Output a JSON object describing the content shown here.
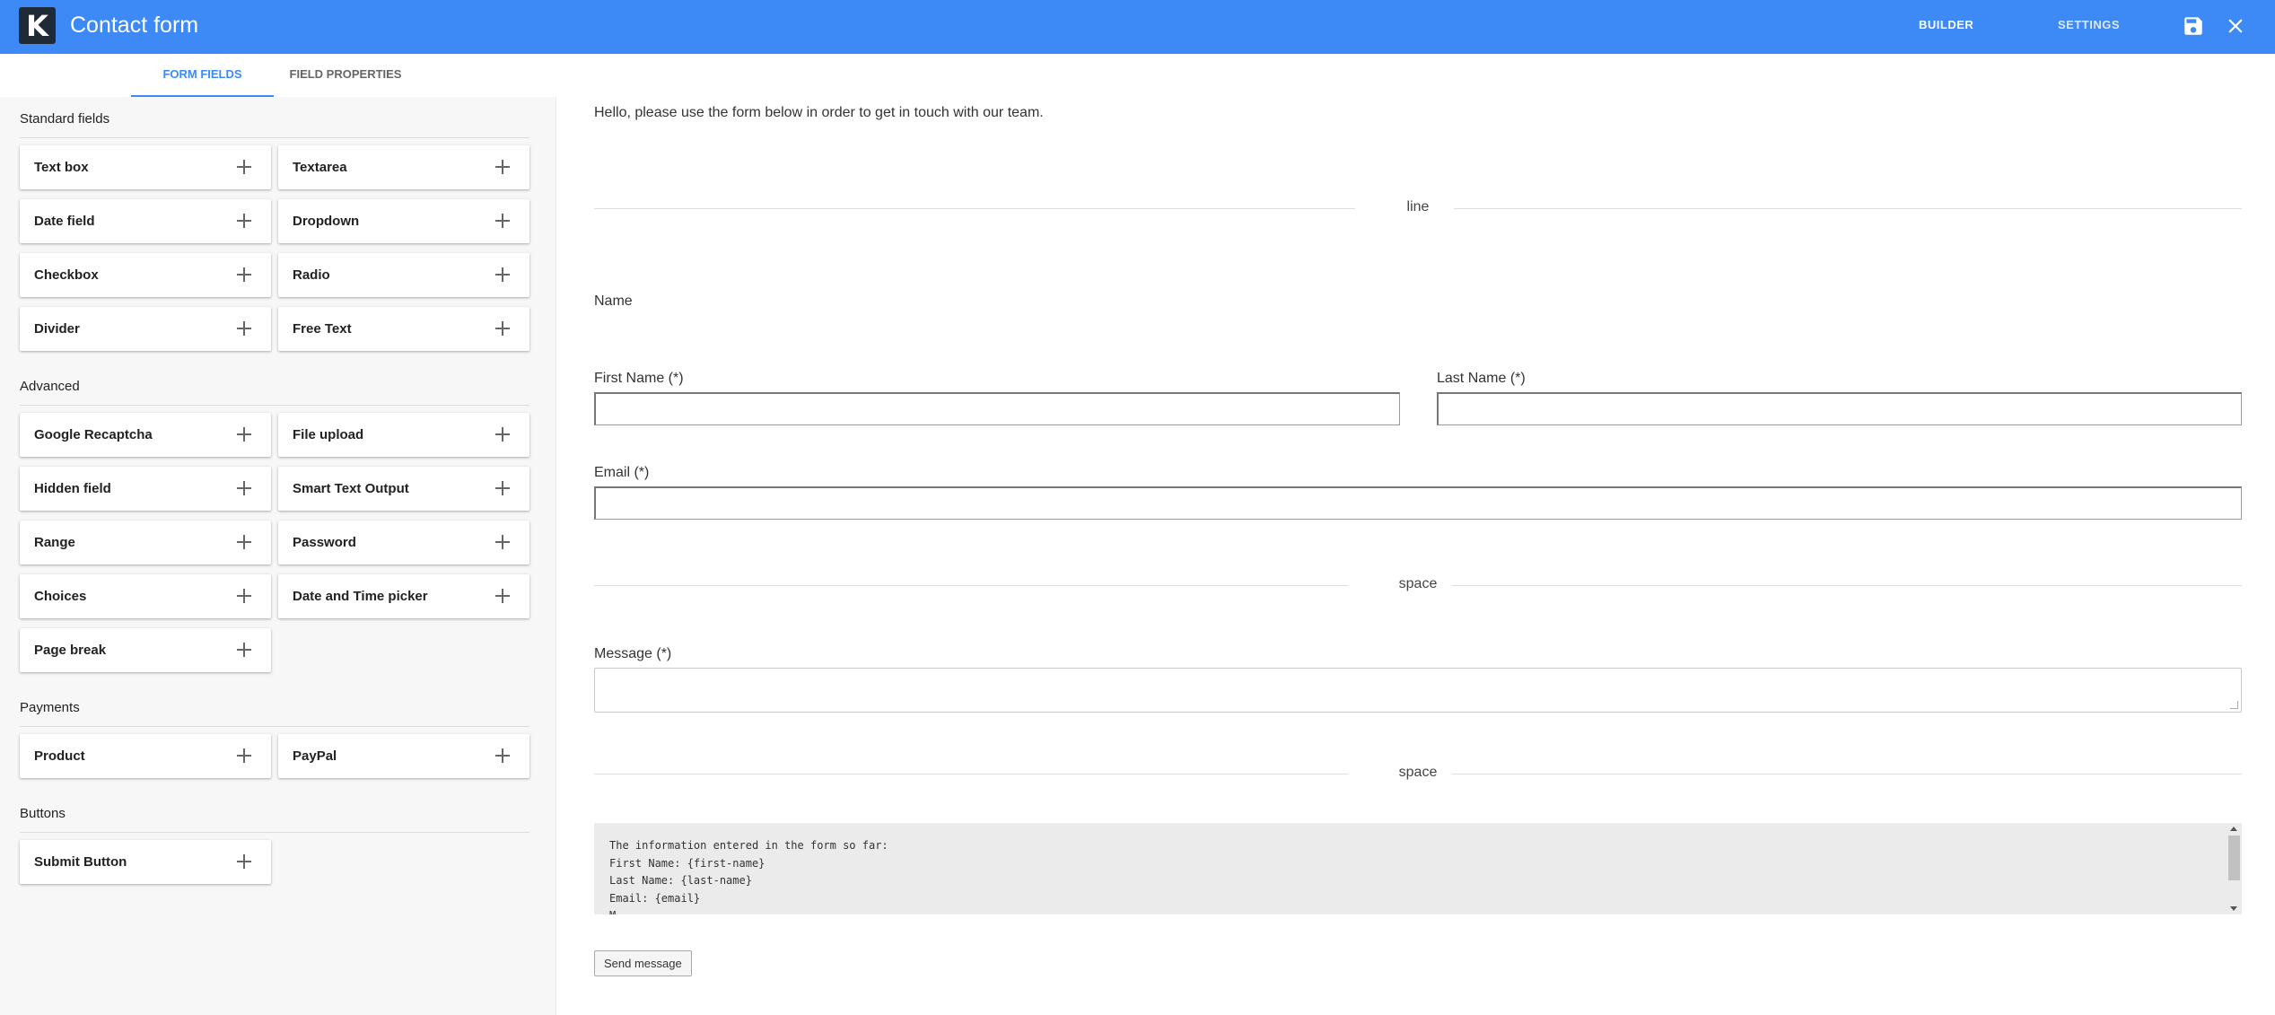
{
  "header": {
    "logo_letter": "K",
    "title": "Contact form",
    "nav": {
      "builder": "BUILDER",
      "settings": "SETTINGS"
    },
    "icons": {
      "save": "save-icon",
      "close": "close-icon"
    },
    "colors": {
      "accent": "#3d8af7",
      "logo_bg": "#1f2a37"
    }
  },
  "sidebar": {
    "tabs": [
      "FORM FIELDS",
      "FIELD PROPERTIES"
    ],
    "active_tab": "FORM FIELDS",
    "sections": [
      {
        "title": "Standard fields",
        "items": [
          "Text box",
          "Textarea",
          "Date field",
          "Dropdown",
          "Checkbox",
          "Radio",
          "Divider",
          "Free Text"
        ]
      },
      {
        "title": "Advanced",
        "items": [
          "Google Recaptcha",
          "File upload",
          "Hidden field",
          "Smart Text Output",
          "Range",
          "Password",
          "Choices",
          "Date and Time picker",
          "Page break"
        ]
      },
      {
        "title": "Payments",
        "items": [
          "Product",
          "PayPal"
        ]
      },
      {
        "title": "Buttons",
        "items": [
          "Submit Button"
        ]
      }
    ]
  },
  "form": {
    "intro": "Hello, please use the form below in order to get in touch with our team.",
    "divider1": "line",
    "name_heading": "Name",
    "first_name_label": "First Name (*)",
    "last_name_label": "Last Name (*)",
    "email_label": "Email (*)",
    "divider2": "space",
    "message_label": "Message (*)",
    "divider3": "space",
    "smart_text_lines": [
      "The information entered in the form so far:",
      "First Name: {first-name}",
      "Last Name: {last-name}",
      "Email: {email}",
      "M"
    ],
    "submit_label": "Send message"
  }
}
